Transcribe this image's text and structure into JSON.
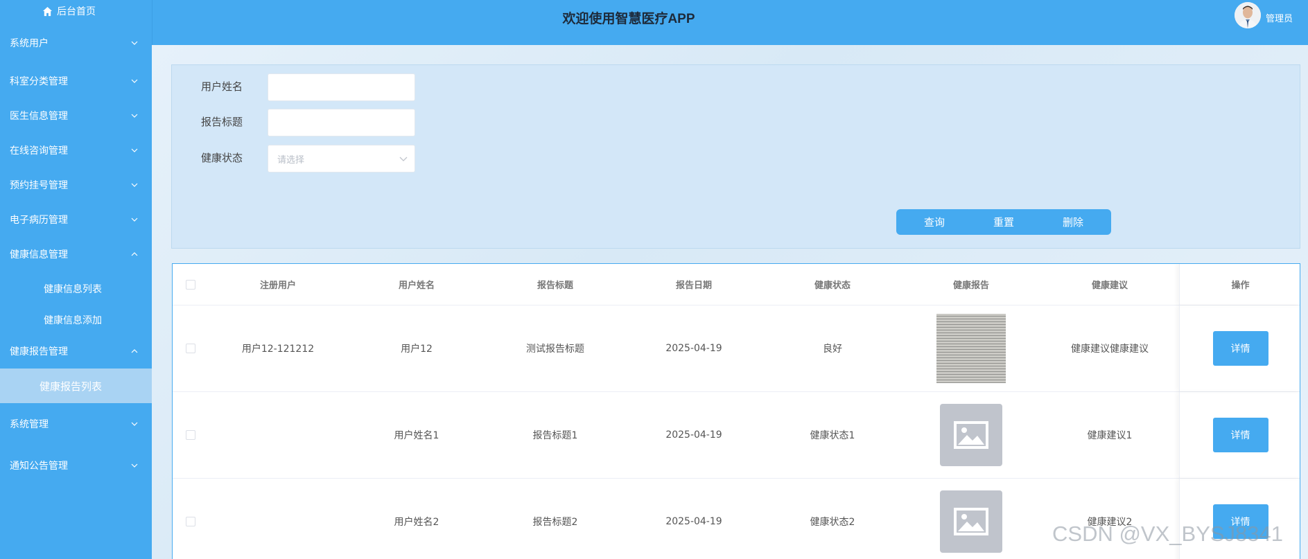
{
  "header": {
    "title": "欢迎使用智慧医疗APP",
    "user": "管理员"
  },
  "sidebar": {
    "home": "后台首页",
    "menus": [
      {
        "label": "系统用户"
      },
      {
        "label": "科室分类管理"
      },
      {
        "label": "医生信息管理"
      },
      {
        "label": "在线咨询管理"
      },
      {
        "label": "预约挂号管理"
      },
      {
        "label": "电子病历管理"
      },
      {
        "label": "健康信息管理",
        "children": [
          "健康信息列表",
          "健康信息添加"
        ]
      },
      {
        "label": "健康报告管理",
        "children": [
          "健康报告列表"
        ]
      },
      {
        "label": "系统管理"
      },
      {
        "label": "通知公告管理"
      }
    ]
  },
  "search": {
    "fields": [
      {
        "label": "用户姓名",
        "value": ""
      },
      {
        "label": "报告标题",
        "value": ""
      },
      {
        "label": "健康状态",
        "placeholder": "请选择"
      }
    ],
    "buttons": {
      "query": "查询",
      "reset": "重置",
      "delete": "删除"
    }
  },
  "table": {
    "columns": [
      "注册用户",
      "用户姓名",
      "报告标题",
      "报告日期",
      "健康状态",
      "健康报告",
      "健康建议",
      "操作"
    ],
    "rows": [
      {
        "user": "用户12-121212",
        "name": "用户12",
        "title": "测试报告标题",
        "date": "2025-04-19",
        "status": "良好",
        "report": "photo",
        "advice": "健康建议健康建议",
        "action": "详情"
      },
      {
        "user": "",
        "name": "用户姓名1",
        "title": "报告标题1",
        "date": "2025-04-19",
        "status": "健康状态1",
        "report": "placeholder",
        "advice": "健康建议1",
        "action": "详情"
      },
      {
        "user": "",
        "name": "用户姓名2",
        "title": "报告标题2",
        "date": "2025-04-19",
        "status": "健康状态2",
        "report": "placeholder",
        "advice": "健康建议2",
        "action": "详情"
      }
    ]
  },
  "watermark": "CSDN @VX_BYSJ8341",
  "colors": {
    "primary": "#45aaf0",
    "active_sub": "#a9d3f3"
  }
}
